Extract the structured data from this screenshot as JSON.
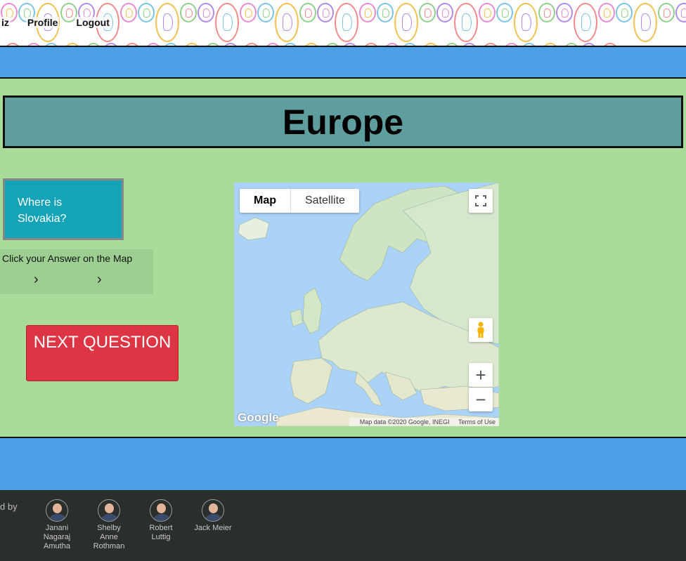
{
  "nav": {
    "quiz_label": "iz",
    "profile_label": "Profile",
    "logout_label": "Logout"
  },
  "quiz": {
    "title": "Europe",
    "question": "Where is Slovakia?",
    "answer_instruction": "Click your Answer on the Map",
    "next_button_label": "NEXT QUESTION"
  },
  "map": {
    "type_options": [
      "Map",
      "Satellite"
    ],
    "selected_type": "Map",
    "zoom_in_label": "+",
    "zoom_out_label": "−",
    "logo_text": "Google",
    "attribution": "Map data ©2020 Google, INEGI",
    "terms_label": "Terms of Use"
  },
  "footer": {
    "made_by_label": "d by",
    "creators": [
      {
        "name": "Janani Nagaraj Amutha"
      },
      {
        "name": "Shelby Anne Rothman"
      },
      {
        "name": "Robert Luttig"
      },
      {
        "name": "Jack Meier"
      }
    ]
  },
  "colors": {
    "header_blue": "#4d9fe6",
    "main_green": "#a8dc98",
    "title_teal": "#5f9e9e",
    "question_cyan": "#14a3b7",
    "next_red": "#dd3544",
    "footer_dark": "#2b2f2b"
  }
}
